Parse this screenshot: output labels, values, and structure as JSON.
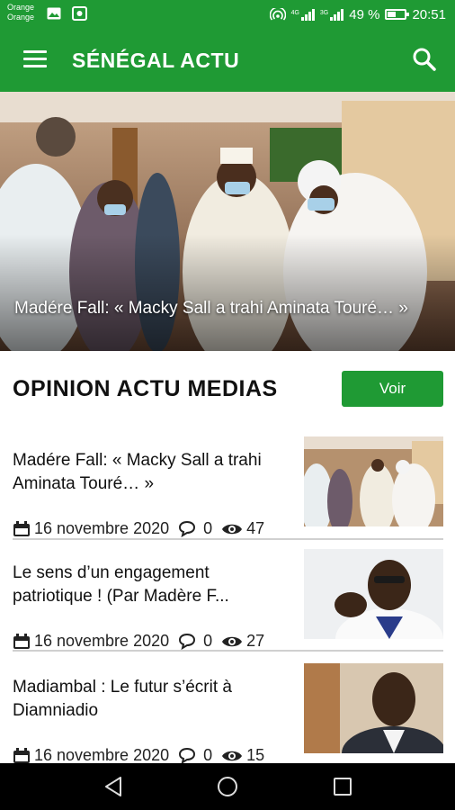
{
  "status_bar": {
    "carrier_line1": "Orange",
    "carrier_line2": "Orange",
    "network_tag1": "4G",
    "network_tag2": "3G",
    "battery": "49 %",
    "time": "20:51"
  },
  "app_bar": {
    "title": "SÉNÉGAL ACTU",
    "menu_icon": "hamburger-menu-icon",
    "search_icon": "search-icon"
  },
  "hero": {
    "caption": "Madére Fall: « Macky Sall a trahi Aminata Touré… »"
  },
  "section": {
    "title": "OPINION ACTU MEDIAS",
    "button_label": "Voir"
  },
  "articles": [
    {
      "title": "Madére Fall: « Macky Sall a trahi Aminata Touré… »",
      "date": "16 novembre 2020",
      "comments": "0",
      "views": "47"
    },
    {
      "title": "Le sens d’un engagement patriotique ! (Par Madère F...",
      "date": "16 novembre 2020",
      "comments": "0",
      "views": "27"
    },
    {
      "title": "Madiambal : Le futur s’écrit à Diamniadio",
      "date": "16 novembre 2020",
      "comments": "0",
      "views": "15"
    }
  ],
  "colors": {
    "brand_green": "#1f9a34",
    "nav_bar": "#000000"
  }
}
